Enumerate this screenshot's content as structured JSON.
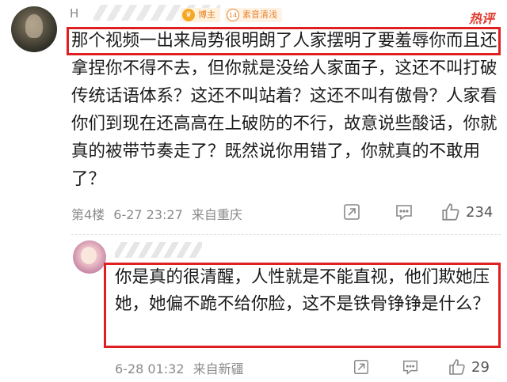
{
  "main_comment": {
    "username": "H",
    "badges": {
      "blogger_label": "博主",
      "fans_level": "14",
      "fans_label": "素音清浅"
    },
    "hot_label": "热评",
    "text": "那个视频一出来局势很明朗了人家摆明了要羞辱你而且还拿捏你不得不去，但你就是没给人家面子，这还不叫打破传统话语体系？这还不叫站着？这还不叫有傲骨？人家看你们到现在还高高在上破防的不行，故意说些酸话，你就真的被带节奏走了？既然说你用错了，你就真的不敢用了？",
    "floor": "第4楼",
    "date": "6-27 23:27",
    "location": "来自重庆",
    "like_count": "234"
  },
  "reply": {
    "username": "",
    "text": "你是真的很清醒，人性就是不能直视，他们欺她压她，她偏不跪不给你脸，这不是铁骨铮铮是什么？",
    "date": "6-28 01:32",
    "location": "来自新疆",
    "like_count": "29"
  },
  "colors": {
    "highlight_border": "#e02020",
    "hot_label": "#e03b2e",
    "meta_text": "#8a8a8a",
    "icon_stroke": "#888888"
  },
  "icons": [
    "share-icon",
    "comment-icon",
    "like-icon"
  ]
}
